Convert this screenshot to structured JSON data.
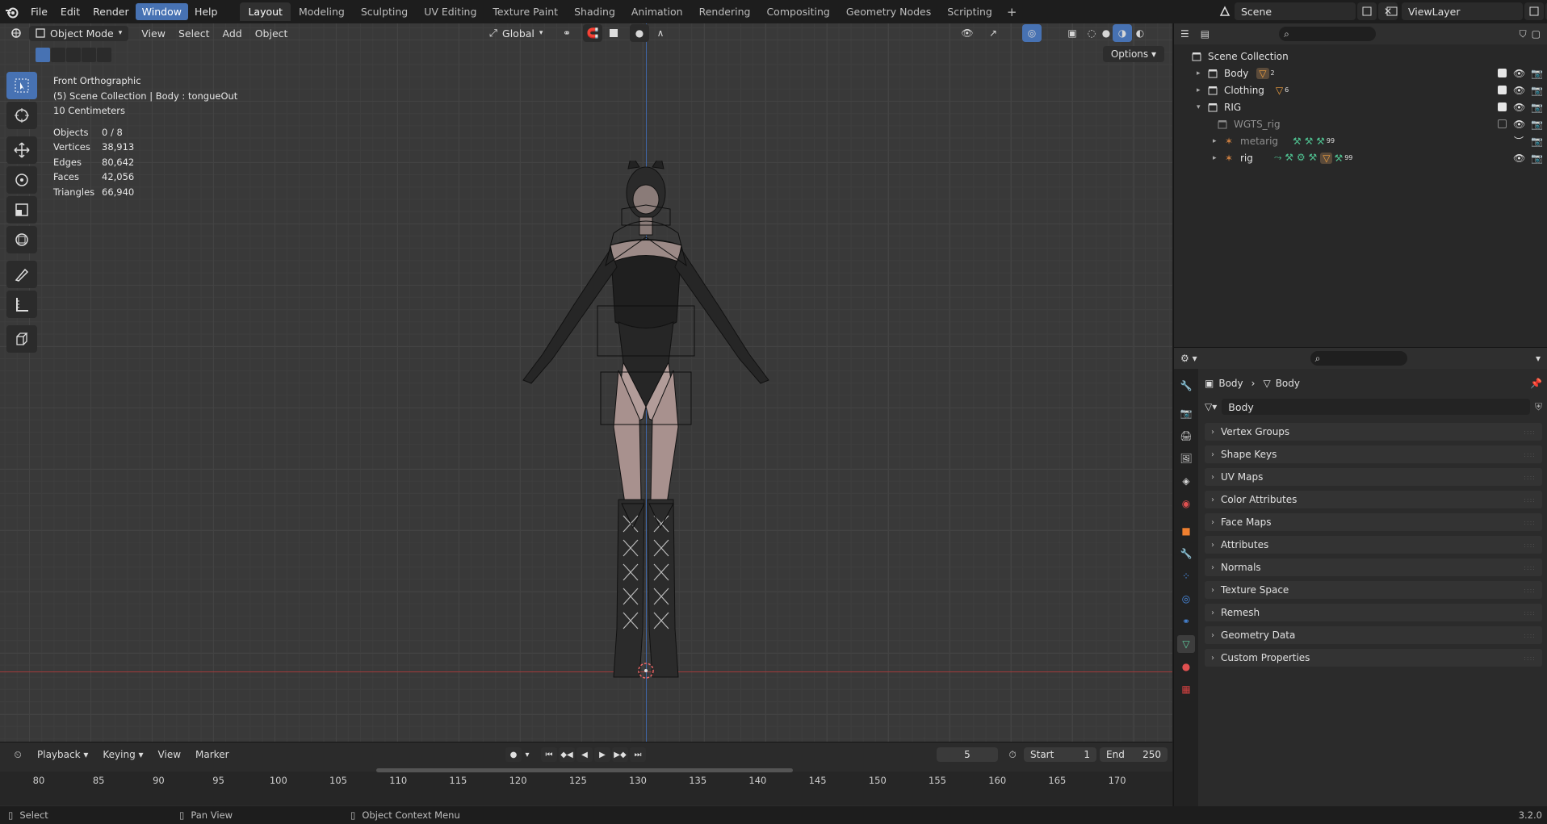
{
  "menubar": {
    "items": [
      "File",
      "Edit",
      "Render",
      "Window",
      "Help"
    ],
    "active_index": 3
  },
  "workspaces": {
    "tabs": [
      "Layout",
      "Modeling",
      "Sculpting",
      "UV Editing",
      "Texture Paint",
      "Shading",
      "Animation",
      "Rendering",
      "Compositing",
      "Geometry Nodes",
      "Scripting"
    ],
    "active_index": 0,
    "add_label": "+"
  },
  "scene": {
    "name": "Scene",
    "view_layer": "ViewLayer"
  },
  "viewport": {
    "mode": "Object Mode",
    "menus": [
      "View",
      "Select",
      "Add",
      "Object"
    ],
    "transform_orientation": "Global",
    "options_label": "Options",
    "overlay": {
      "view_name": "Front Orthographic",
      "context": "(5) Scene Collection | Body : tongueOut",
      "scale": "10 Centimeters",
      "stats": [
        {
          "k": "Objects",
          "v": "0 / 8"
        },
        {
          "k": "Vertices",
          "v": "38,913"
        },
        {
          "k": "Edges",
          "v": "80,642"
        },
        {
          "k": "Faces",
          "v": "42,056"
        },
        {
          "k": "Triangles",
          "v": "66,940"
        }
      ]
    },
    "tools": [
      "select-box",
      "cursor",
      "move",
      "rotate",
      "scale",
      "transform",
      "annotate",
      "measure",
      "add-cube"
    ]
  },
  "timeline": {
    "menus": [
      "Playback",
      "Keying",
      "View",
      "Marker"
    ],
    "current_frame": "5",
    "start_label": "Start",
    "start": "1",
    "end_label": "End",
    "end": "250",
    "ruler": [
      "80",
      "85",
      "90",
      "95",
      "100",
      "105",
      "110",
      "115",
      "120",
      "125",
      "130",
      "135",
      "140",
      "145",
      "150",
      "155",
      "160",
      "165",
      "170"
    ]
  },
  "statusbar": {
    "select": "Select",
    "pan": "Pan View",
    "context_menu": "Object Context Menu",
    "version": "3.2.0"
  },
  "outliner": {
    "root": "Scene Collection",
    "rows": [
      {
        "label": "Body",
        "badge": "2",
        "dim": false
      },
      {
        "label": "Clothing",
        "badge": "6",
        "dim": false
      },
      {
        "label": "RIG",
        "badge": "",
        "dim": false
      },
      {
        "label": "WGTS_rig",
        "badge": "",
        "dim": true
      },
      {
        "label": "metarig",
        "badge": "99",
        "dim": true
      },
      {
        "label": "rig",
        "badge": "99",
        "dim": false
      }
    ]
  },
  "properties": {
    "breadcrumb": [
      "Body",
      "Body"
    ],
    "data_name": "Body",
    "panels": [
      "Vertex Groups",
      "Shape Keys",
      "UV Maps",
      "Color Attributes",
      "Face Maps",
      "Attributes",
      "Normals",
      "Texture Space",
      "Remesh",
      "Geometry Data",
      "Custom Properties"
    ]
  },
  "colors": {
    "accent": "#4772b3",
    "x_axis": "#a33a3a",
    "z_axis": "#3f67a8",
    "mesh_data": "#5fd0a0"
  }
}
